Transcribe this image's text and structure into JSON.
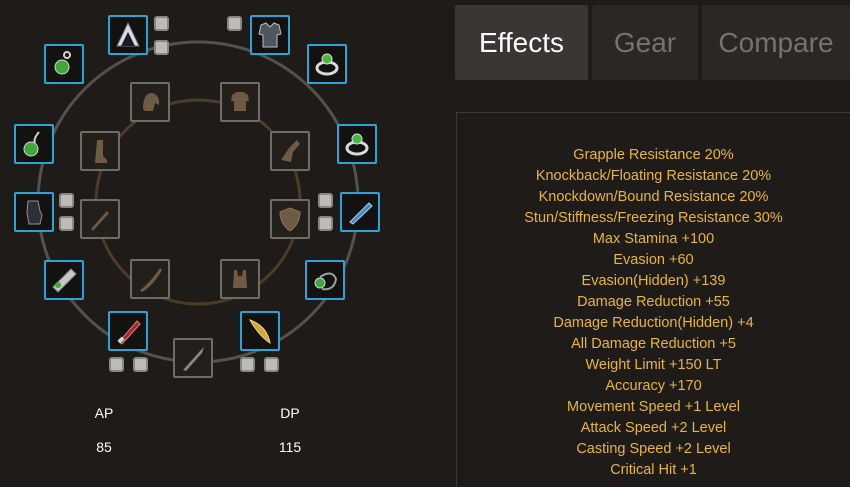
{
  "tabs": [
    {
      "label": "Effects",
      "active": true
    },
    {
      "label": "Gear",
      "active": false
    },
    {
      "label": "Compare",
      "active": false
    }
  ],
  "stats": {
    "ap_label": "AP",
    "ap_value": "85",
    "dp_label": "DP",
    "dp_value": "115"
  },
  "effects": [
    "Grapple Resistance 20%",
    "Knockback/Floating Resistance 20%",
    "Knockdown/Bound Resistance 20%",
    "Stun/Stiffness/Freezing Resistance 30%",
    "Max Stamina +100",
    "Evasion +60",
    "Evasion(Hidden) +139",
    "Damage Reduction +55",
    "Damage Reduction(Hidden) +4",
    "All Damage Reduction +5",
    "Weight Limit +150 LT",
    "Accuracy +170",
    "Movement Speed +1 Level",
    "Attack Speed +2 Level",
    "Casting Speed +2 Level",
    "Critical Hit +1"
  ],
  "equipped_slots": [
    {
      "name": "helmet-slot",
      "icon": "helmet-icon"
    },
    {
      "name": "armor-slot",
      "icon": "armor-icon"
    },
    {
      "name": "earring-left-slot",
      "icon": "earring-icon"
    },
    {
      "name": "ring-right-top-slot",
      "icon": "ring-icon"
    },
    {
      "name": "necklace-slot",
      "icon": "necklace-icon"
    },
    {
      "name": "ring-right-slot",
      "icon": "ring-icon"
    },
    {
      "name": "gloves-slot",
      "icon": "gloves-icon"
    },
    {
      "name": "sub-weapon-slot",
      "icon": "sub-weapon-icon"
    },
    {
      "name": "belt-slot",
      "icon": "belt-icon"
    },
    {
      "name": "earring-right-slot",
      "icon": "earring-icon"
    },
    {
      "name": "main-weapon-slot",
      "icon": "main-weapon-icon"
    },
    {
      "name": "awakening-weapon-slot",
      "icon": "awakening-weapon-icon"
    }
  ],
  "empty_slots": [
    {
      "name": "costume-head-slot",
      "icon": "costume-head-icon"
    },
    {
      "name": "costume-chest-slot",
      "icon": "costume-chest-icon"
    },
    {
      "name": "costume-boots-slot",
      "icon": "costume-boots-icon"
    },
    {
      "name": "costume-gloves-slot",
      "icon": "costume-gloves-icon"
    },
    {
      "name": "costume-dagger-slot",
      "icon": "costume-dagger-icon"
    },
    {
      "name": "costume-shield-slot",
      "icon": "costume-shield-icon"
    },
    {
      "name": "costume-sword-slot",
      "icon": "costume-sword-icon"
    },
    {
      "name": "costume-underwear-slot",
      "icon": "costume-underwear-icon"
    },
    {
      "name": "costume-blade-slot",
      "icon": "costume-blade-icon"
    }
  ],
  "colors": {
    "equipped_border": "#2aa3d6",
    "empty_border": "#6f6c68",
    "effect_text": "#e6b635",
    "background": "#1f1b18"
  }
}
